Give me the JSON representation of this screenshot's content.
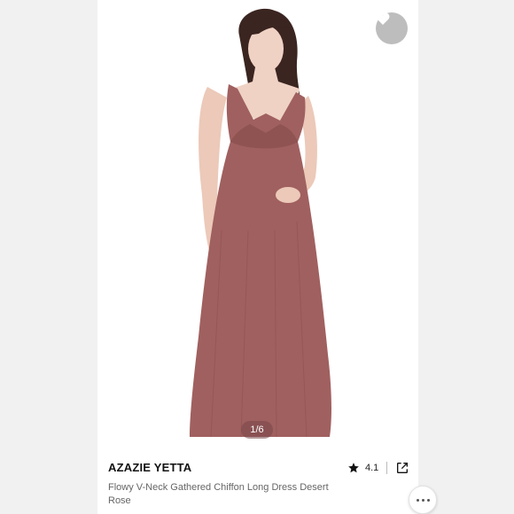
{
  "product": {
    "brand": "AZAZIE YETTA",
    "title": "Flowy V-Neck Gathered Chiffon Long Dress Desert Rose",
    "rating": "4.1",
    "image_counter": "1/6"
  },
  "icons": {
    "favorite": "heart-icon",
    "rating": "star-icon",
    "share": "share-external-icon",
    "chat": "chat-bubble-icon"
  },
  "colors": {
    "dress": "#a0605f",
    "favorite_bg": "#bdbdbd",
    "background": "#f1f1f1"
  }
}
